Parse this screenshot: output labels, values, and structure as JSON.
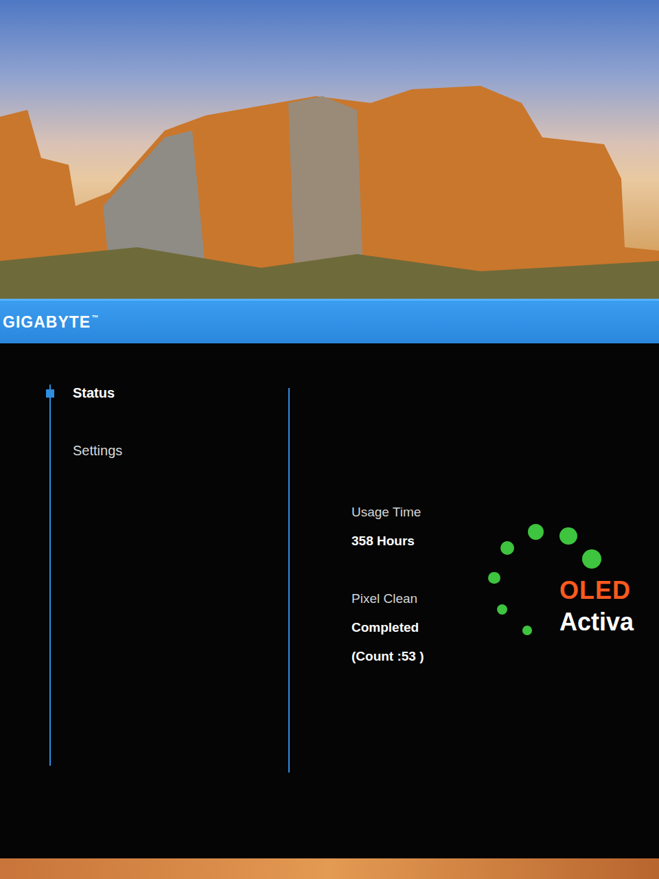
{
  "header": {
    "logo": "GIGABYTE",
    "trademark": "™"
  },
  "sidebar": {
    "items": [
      {
        "label": "Status",
        "selected": true
      },
      {
        "label": "Settings",
        "selected": false
      }
    ]
  },
  "status": {
    "usage_label": "Usage Time",
    "usage_value": "358 Hours",
    "pixel_clean_label": "Pixel Clean",
    "pixel_clean_value": "Completed",
    "count": "(Count :53 )"
  },
  "spinner": {
    "dots": [
      {
        "level": 1
      },
      {
        "level": 0.85
      },
      {
        "level": 0.7
      },
      {
        "level": 0.5
      },
      {
        "level": 0.35
      },
      {
        "level": 0.2
      },
      {
        "level": 0.1
      }
    ]
  },
  "indicator": {
    "title": "OLED",
    "subtitle": "Activa"
  }
}
